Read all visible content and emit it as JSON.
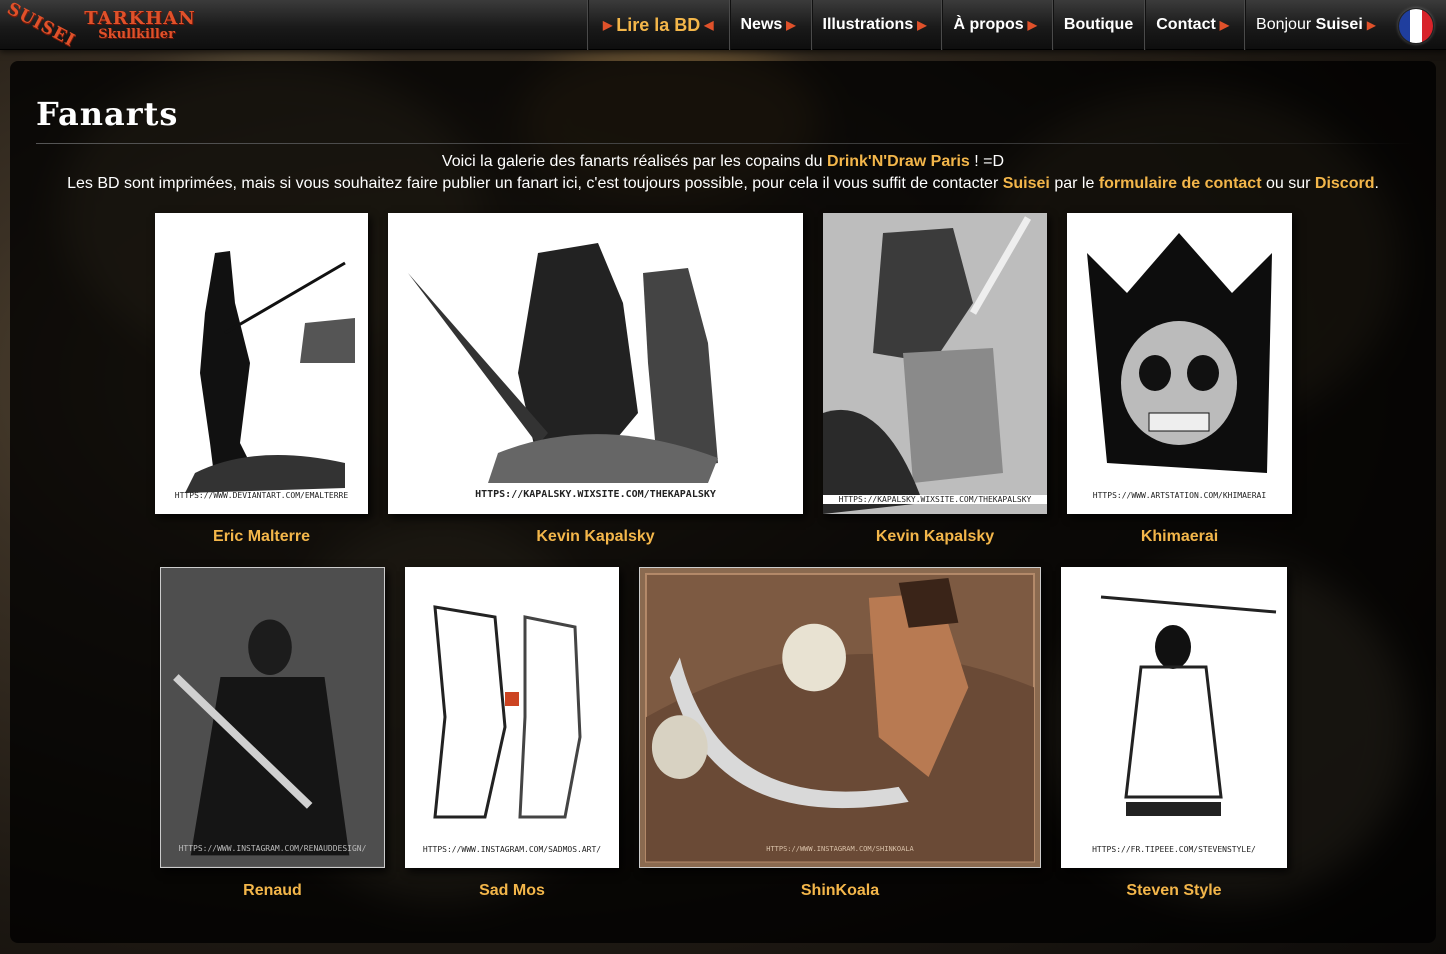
{
  "nav": {
    "logo_left": "SUISEI",
    "logo_title": "TARKHAN",
    "logo_subtitle": "Skullkiller",
    "items": [
      {
        "label": "Lire la BD"
      },
      {
        "label": "News"
      },
      {
        "label": "Illustrations"
      },
      {
        "label": "À propos"
      },
      {
        "label": "Boutique"
      },
      {
        "label": "Contact"
      }
    ],
    "greeting_prefix": "Bonjour",
    "greeting_name": "Suisei",
    "language_icon": "flag-france-icon"
  },
  "page": {
    "title": "Fanarts",
    "intro": {
      "line1_before": "Voici la galerie des fanarts réalisés par les copains du",
      "line1_link": "Drink'N'Draw Paris",
      "line1_after": "! =D",
      "line2_before": "Les BD sont imprimées, mais si vous souhaitez faire publier un fanart ici, c'est toujours possible, pour cela il vous suffit de contacter",
      "line2_link1": "Suisei",
      "line2_mid1": "par le",
      "line2_link2": "formulaire de contact",
      "line2_mid2": "ou sur",
      "line2_link3": "Discord",
      "line2_end": "."
    }
  },
  "gallery": [
    {
      "artist": "Eric Malterre",
      "url": "HTTPS://WWW.DEVIANTART.COM/EMALTERRE"
    },
    {
      "artist": "Kevin Kapalsky",
      "url": "HTTPS://KAPALSKY.WIXSITE.COM/THEKAPALSKY"
    },
    {
      "artist": "Kevin Kapalsky",
      "url": "HTTPS://KAPALSKY.WIXSITE.COM/THEKAPALSKY"
    },
    {
      "artist": "Khimaerai",
      "url": "HTTPS://WWW.ARTSTATION.COM/KHIMAERAI"
    },
    {
      "artist": "Renaud",
      "url": "HTTPS://WWW.INSTAGRAM.COM/RENAUDDESIGN/"
    },
    {
      "artist": "Sad Mos",
      "url": "HTTPS://WWW.INSTAGRAM.COM/SADMOS.ART/"
    },
    {
      "artist": "ShinKoala",
      "url": "HTTPS://WWW.INSTAGRAM.COM/SHINKOALA"
    },
    {
      "artist": "Steven Style",
      "url": "HTTPS://FR.TIPEEE.COM/STEVENSTYLE/"
    }
  ],
  "colors": {
    "accent": "#f3b64a",
    "logo_red": "#e0512a"
  }
}
